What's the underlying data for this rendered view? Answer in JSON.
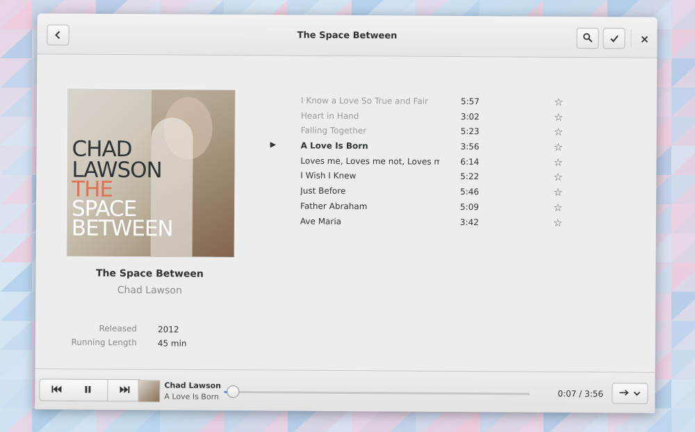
{
  "window": {
    "title": "The Space Between"
  },
  "album": {
    "title": "The Space Between",
    "artist": "Chad Lawson",
    "cover_lines": [
      "CHAD",
      "LAWSON",
      "THE",
      "SPACE",
      "BETWEEN"
    ],
    "released_label": "Released",
    "released_value": "2012",
    "length_label": "Running Length",
    "length_value": "45 min"
  },
  "tracks": [
    {
      "name": "I Know a Love So True and Fair",
      "duration": "5:57",
      "state": "played"
    },
    {
      "name": "Heart in Hand",
      "duration": "3:02",
      "state": "played"
    },
    {
      "name": "Falling Together",
      "duration": "5:23",
      "state": "played"
    },
    {
      "name": "A Love Is Born",
      "duration": "3:56",
      "state": "playing"
    },
    {
      "name": "Loves me, Loves me not, Loves me",
      "duration": "6:14",
      "state": "normal"
    },
    {
      "name": "I Wish I Knew",
      "duration": "5:22",
      "state": "normal"
    },
    {
      "name": "Just Before",
      "duration": "5:46",
      "state": "normal"
    },
    {
      "name": "Father Abraham",
      "duration": "5:09",
      "state": "normal"
    },
    {
      "name": "Ave Maria",
      "duration": "3:42",
      "state": "normal"
    }
  ],
  "icons": {
    "back": "back-icon",
    "search": "search-icon",
    "select": "check-icon",
    "close": "close-icon",
    "star": "star-outline-icon",
    "playing": "play-indicator-icon",
    "prev": "previous-icon",
    "pause": "pause-icon",
    "next": "next-icon",
    "repeat": "repeat-icon",
    "dropdown": "chevron-down-icon"
  },
  "player": {
    "artist": "Chad Lawson",
    "title": "A Love Is Born",
    "elapsed": "0:07",
    "separator": "/",
    "total": "3:56",
    "progress_fraction": 0.03
  },
  "colors": {
    "accent": "#4a90d9",
    "cover_highlight": "#e07050"
  }
}
